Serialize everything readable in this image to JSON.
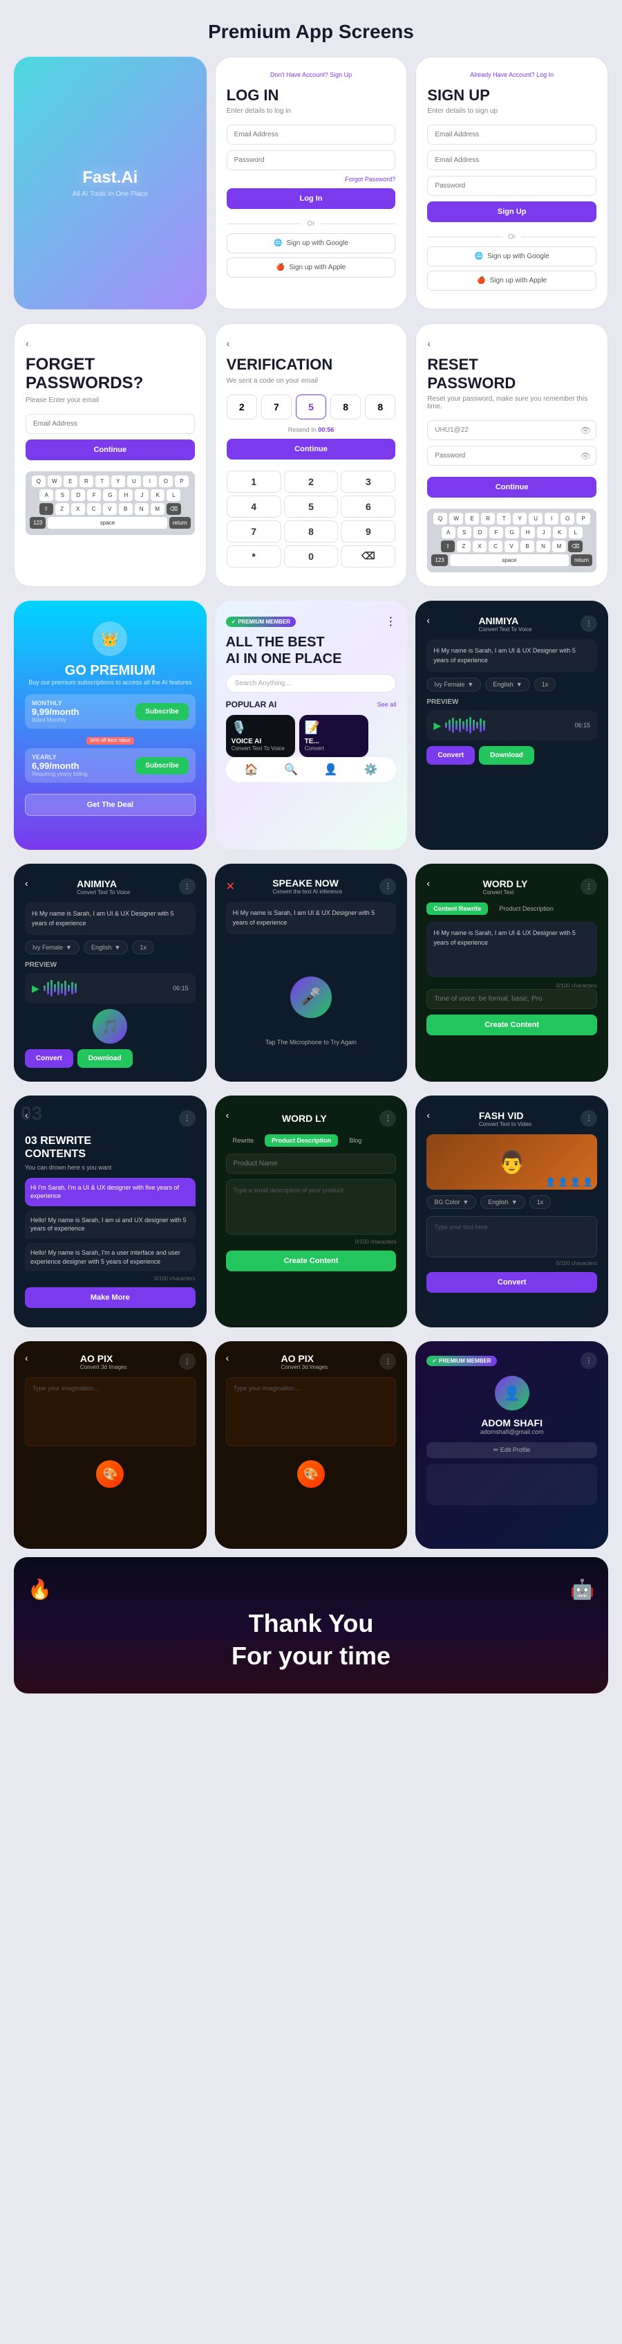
{
  "page": {
    "title": "Premium App Screens"
  },
  "row1": {
    "screens": [
      {
        "id": "logo",
        "type": "teal",
        "logo": "Fast.Ai",
        "tagline": "All AI Tools In One Place"
      },
      {
        "id": "login",
        "type": "white",
        "top_link": "Don't Have Account? Sign Up",
        "title": "LOG IN",
        "subtitle": "Enter details to log in",
        "email_placeholder": "Email Address",
        "password_placeholder": "Password",
        "forgot_label": "Forgot Password?",
        "btn_label": "Log In",
        "or_text": "Or",
        "google_label": "Sign up with Google",
        "apple_label": "Sign up with Apple"
      },
      {
        "id": "signup",
        "type": "white",
        "top_link": "Already Have Account? Log In",
        "title": "SIGN UP",
        "subtitle": "Enter details to sign up",
        "email_placeholder": "Email Address",
        "email2_placeholder": "Email Address",
        "password_placeholder": "Password",
        "btn_label": "Sign Up",
        "or_text": "Or",
        "google_label": "Sign up with Google",
        "apple_label": "Sign up with Apple"
      }
    ]
  },
  "row2": {
    "screens": [
      {
        "id": "forgot",
        "title": "FORGET\nPASSWORDS?",
        "subtitle": "Please Enter your email",
        "email_placeholder": "Email Address",
        "btn_label": "Continue",
        "keyboard_rows": [
          [
            "Q",
            "W",
            "E",
            "R",
            "T",
            "Y",
            "U",
            "I",
            "O",
            "P"
          ],
          [
            "A",
            "S",
            "D",
            "F",
            "G",
            "H",
            "J",
            "K",
            "L"
          ],
          [
            "⇧",
            "Z",
            "X",
            "C",
            "V",
            "B",
            "N",
            "M",
            "⌫"
          ],
          [
            "123",
            "space",
            "return"
          ]
        ]
      },
      {
        "id": "verification",
        "title": "VERIFICATION",
        "subtitle": "We sent a code on your email",
        "codes": [
          "2",
          "7",
          "5",
          "8",
          "8"
        ],
        "resend_text": "Resend In",
        "timer": "00:56",
        "btn_label": "Continue",
        "num_pad": [
          [
            "1",
            "2",
            "3"
          ],
          [
            "4",
            "5",
            "6"
          ],
          [
            "7",
            "8",
            "9"
          ],
          [
            "*",
            "0",
            "⌫"
          ]
        ]
      },
      {
        "id": "reset",
        "title": "RESET\nPASSWORD",
        "subtitle": "Reset your password, make sure you remember this time.",
        "password1_placeholder": "UHU1@22",
        "password2_placeholder": "Password",
        "btn_label": "Continue",
        "keyboard_rows": [
          [
            "Q",
            "W",
            "E",
            "R",
            "T",
            "Y",
            "U",
            "I",
            "O",
            "P"
          ],
          [
            "A",
            "S",
            "D",
            "F",
            "G",
            "H",
            "J",
            "K",
            "L"
          ],
          [
            "⇧",
            "Z",
            "X",
            "C",
            "V",
            "B",
            "N",
            "M",
            "⌫"
          ],
          [
            "123",
            "space",
            "return"
          ]
        ]
      }
    ]
  },
  "row3": {
    "screens": [
      {
        "id": "premium",
        "type": "cyan_dark",
        "title": "GO PREMIUM",
        "subtitle": "Buy our premium subscriptions to access all the AI features",
        "monthly_label": "MONTHLY",
        "monthly_price": "9,99/month",
        "monthly_sub": "Billed Monthly",
        "monthly_btn": "Subscribe",
        "yearly_badge": "30% off Best Value",
        "yearly_label": "YEARLY",
        "yearly_price": "6,99/month",
        "yearly_sub": "Requiring yearly billing",
        "yearly_btn": "Subscribe",
        "deal_btn": "Get The Deal"
      },
      {
        "id": "ai_home",
        "type": "light",
        "badge": "PREMIUM MEMBER",
        "title": "ALL THE BEST\nAI IN ONE PLACE",
        "search_placeholder": "Search Anything...",
        "popular_label": "POPULAR AI",
        "see_all_label": "See all",
        "voice_ai_title": "VOICE AI",
        "voice_ai_sub": "Convert Text To Voice",
        "nav_items": [
          "home",
          "explore",
          "profile",
          "settings"
        ]
      },
      {
        "id": "animiya_main",
        "type": "dark_navy",
        "title": "ANIMIYA",
        "subtitle": "Convert Text To Voice",
        "text_content": "Hi My name is Sarah, I am UI & UX Designer with 5 years of experience",
        "voice_select": "Ivy Female",
        "lang_select": "English",
        "speed_select": "1x",
        "preview_label": "PREVIEW",
        "time_label": "06:15",
        "convert_btn": "Convert",
        "download_btn": "Download"
      }
    ]
  },
  "row4": {
    "screens": [
      {
        "id": "animiya_v2",
        "type": "dark_navy",
        "title": "ANIMIYA",
        "subtitle": "Convert Text To Voice",
        "text_content": "Hi My name is Sarah, I am UI & UX Designer with 5 years of experience",
        "voice_select": "Ivy Female",
        "lang_select": "English",
        "speed_select": "1x",
        "preview_label": "PREVIEW",
        "time_label": "06:15",
        "convert_btn": "Convert",
        "download_btn": "Download"
      },
      {
        "id": "speake_now",
        "type": "dark_navy",
        "title": "SPEAKE NOW",
        "subtitle": "Convert the text AI inference",
        "text_content": "Hi My name is Sarah, I am UI & UX Designer with 5 years of experience",
        "mic_label": "Tap The Microphone to Try Again"
      },
      {
        "id": "wordly_v1",
        "type": "dark_green",
        "title": "WORD LY",
        "subtitle": "Convert Text",
        "tab1": "Content Rewrite",
        "tab2": "Product Description",
        "text_content": "Hi My name is Sarah, I am UI & UX Designer with 5 years of experience",
        "char_count": "0/100 characters",
        "tone_placeholder": "Tone of voice: be formal, basic, Pro",
        "create_btn": "Create Content"
      }
    ]
  },
  "row5": {
    "screens": [
      {
        "id": "rewrite",
        "type": "dark_navy",
        "section_num": "03",
        "title": "03 REWRITE\nCONTENTS",
        "subtitle": "You can drown here s you want",
        "chat1": "Hi I'm Sarah, I'm a UI & UX designer with five years of experience",
        "chat2": "Hello! My name is Sarah, I am ui and UX designer with 5 years of experience",
        "chat3": "Hello! My name is Sarah, I'm a user interface and user experience designer with 5 years of experience",
        "char_count": "0/100 characters",
        "make_more_btn": "Make More"
      },
      {
        "id": "wordly_product",
        "type": "dark_green",
        "title": "WORD LY",
        "tab1": "Rewrite",
        "tab2": "Product Description",
        "tab3": "Blog",
        "product_name_placeholder": "Product Name",
        "description_placeholder": "Type a small description of your product",
        "char_count": "0/100 characters",
        "create_btn": "Create Content"
      },
      {
        "id": "fashvid",
        "type": "dark_navy",
        "title": "FASH VID",
        "subtitle": "Convert Text to Video",
        "bg_color_label": "BG Color",
        "lang_select": "English",
        "speed_select": "1x",
        "text_placeholder": "Type your text here",
        "char_count": "0/100 characters",
        "convert_btn": "Convert"
      }
    ]
  },
  "row6": {
    "screens": [
      {
        "id": "aopix1",
        "type": "dark_brown",
        "title": "AO PIX",
        "subtitle": "Convert 3d Images",
        "prompt_placeholder": "Type your imagination..."
      },
      {
        "id": "aopix2",
        "type": "dark_brown",
        "title": "AO PIX",
        "subtitle": "Convert 3d Images",
        "prompt_placeholder": "Type your imagination..."
      },
      {
        "id": "adom_profile",
        "type": "dark_profile",
        "badge": "PREMIUM MEMBER",
        "name": "ADOM SHAFI",
        "email": "adomshafi@gmail.com",
        "edit_label": "✏ Edit Profile"
      }
    ]
  },
  "footer": {
    "thank_you_line1": "Thank You",
    "thank_you_line2": "For your time"
  }
}
